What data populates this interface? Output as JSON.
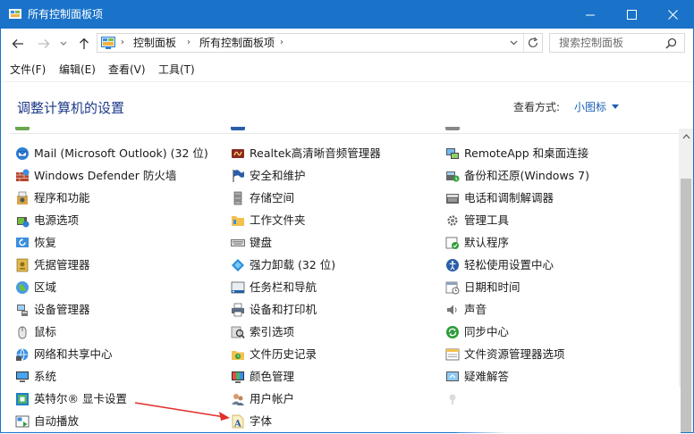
{
  "window": {
    "title": "所有控制面板项",
    "accent": "#1a73c9"
  },
  "address": {
    "crumbs": [
      "控制面板",
      "所有控制面板项"
    ]
  },
  "search": {
    "placeholder": "搜索控制面板"
  },
  "menus": [
    "文件(F)",
    "编辑(E)",
    "查看(V)",
    "工具(T)"
  ],
  "content": {
    "heading": "调整计算机的设置",
    "view_by_label": "查看方式:",
    "view_by_value": "小图标"
  },
  "items": {
    "col1": [
      {
        "label": "Mail (Microsoft Outlook) (32 位)",
        "icon": "mail-icon"
      },
      {
        "label": "Windows Defender 防火墙",
        "icon": "firewall-icon"
      },
      {
        "label": "程序和功能",
        "icon": "programs-icon"
      },
      {
        "label": "电源选项",
        "icon": "power-icon"
      },
      {
        "label": "恢复",
        "icon": "recovery-icon"
      },
      {
        "label": "凭据管理器",
        "icon": "credential-icon"
      },
      {
        "label": "区域",
        "icon": "region-icon"
      },
      {
        "label": "设备管理器",
        "icon": "device-manager-icon"
      },
      {
        "label": "鼠标",
        "icon": "mouse-icon"
      },
      {
        "label": "网络和共享中心",
        "icon": "network-icon"
      },
      {
        "label": "系统",
        "icon": "system-icon"
      },
      {
        "label": "英特尔® 显卡设置",
        "icon": "intel-graphics-icon"
      },
      {
        "label": "自动播放",
        "icon": "autoplay-icon"
      }
    ],
    "col2": [
      {
        "label": "Realtek高清晰音频管理器",
        "icon": "realtek-audio-icon"
      },
      {
        "label": "安全和维护",
        "icon": "security-flag-icon"
      },
      {
        "label": "存储空间",
        "icon": "storage-icon"
      },
      {
        "label": "工作文件夹",
        "icon": "work-folder-icon"
      },
      {
        "label": "键盘",
        "icon": "keyboard-icon"
      },
      {
        "label": "强力卸载 (32 位)",
        "icon": "uninstall-icon"
      },
      {
        "label": "任务栏和导航",
        "icon": "taskbar-icon"
      },
      {
        "label": "设备和打印机",
        "icon": "printer-icon"
      },
      {
        "label": "索引选项",
        "icon": "index-icon"
      },
      {
        "label": "文件历史记录",
        "icon": "file-history-icon"
      },
      {
        "label": "颜色管理",
        "icon": "color-management-icon"
      },
      {
        "label": "用户帐户",
        "icon": "user-accounts-icon"
      },
      {
        "label": "字体",
        "icon": "fonts-icon"
      }
    ],
    "col3": [
      {
        "label": "RemoteApp 和桌面连接",
        "icon": "remoteapp-icon"
      },
      {
        "label": "备份和还原(Windows 7)",
        "icon": "backup-icon"
      },
      {
        "label": "电话和调制解调器",
        "icon": "phone-modem-icon"
      },
      {
        "label": "管理工具",
        "icon": "admin-tools-icon"
      },
      {
        "label": "默认程序",
        "icon": "default-programs-icon"
      },
      {
        "label": "轻松使用设置中心",
        "icon": "ease-of-access-icon"
      },
      {
        "label": "日期和时间",
        "icon": "date-time-icon"
      },
      {
        "label": "声音",
        "icon": "sound-icon"
      },
      {
        "label": "同步中心",
        "icon": "sync-center-icon"
      },
      {
        "label": "文件资源管理器选项",
        "icon": "explorer-options-icon"
      },
      {
        "label": "疑难解答",
        "icon": "troubleshoot-icon"
      }
    ]
  }
}
